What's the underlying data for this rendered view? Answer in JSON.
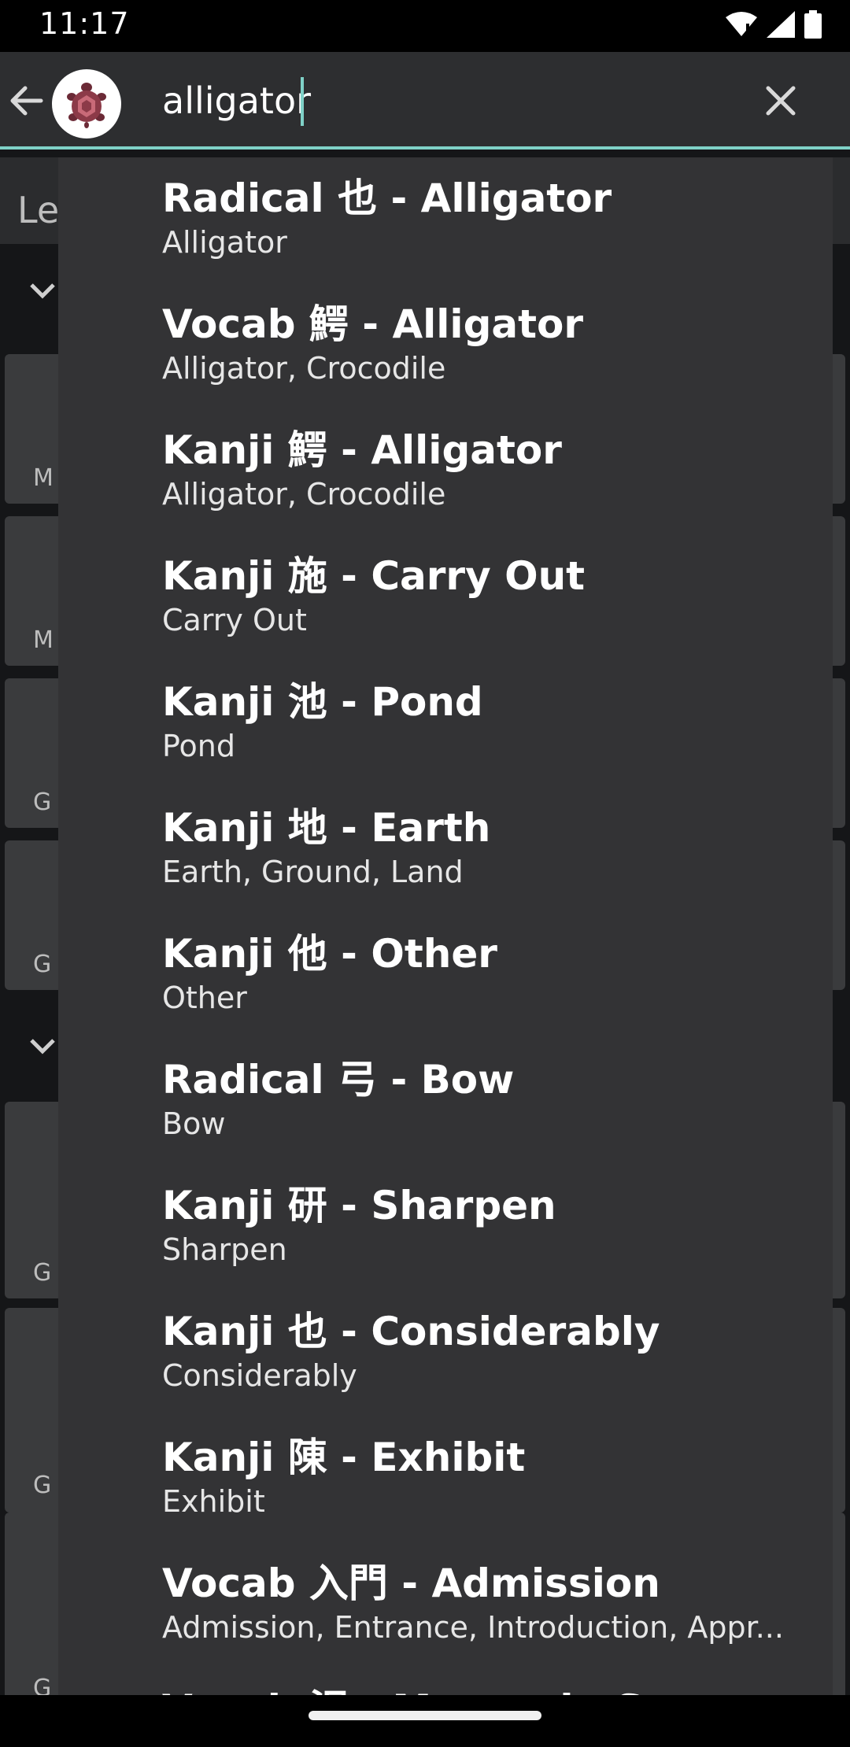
{
  "status": {
    "time": "11:17"
  },
  "toolbar": {
    "search_value": "alligator"
  },
  "background": {
    "header_text": "Le",
    "card_letters": [
      "M",
      "M",
      "G",
      "G",
      "G",
      "G",
      "G"
    ]
  },
  "suggestions": [
    {
      "title": "Radical 也 - Alligator",
      "subtitle": "Alligator"
    },
    {
      "title": "Vocab 鰐 - Alligator",
      "subtitle": "Alligator, Crocodile"
    },
    {
      "title": "Kanji 鰐 - Alligator",
      "subtitle": "Alligator, Crocodile"
    },
    {
      "title": "Kanji 施 - Carry Out",
      "subtitle": "Carry Out"
    },
    {
      "title": "Kanji 池 - Pond",
      "subtitle": "Pond"
    },
    {
      "title": "Kanji 地 - Earth",
      "subtitle": "Earth, Ground, Land"
    },
    {
      "title": "Kanji 他 - Other",
      "subtitle": "Other"
    },
    {
      "title": "Radical 弓 - Bow",
      "subtitle": "Bow"
    },
    {
      "title": "Kanji 研 - Sharpen",
      "subtitle": "Sharpen"
    },
    {
      "title": "Kanji 也 - Considerably",
      "subtitle": "Considerably"
    },
    {
      "title": "Kanji 陳 - Exhibit",
      "subtitle": "Exhibit"
    },
    {
      "title": "Vocab 入門 - Admission",
      "subtitle": "Admission, Entrance, Introduction, Appr..."
    },
    {
      "title": "Vocab 沢 - Mountain Stream",
      "subtitle": ""
    }
  ]
}
